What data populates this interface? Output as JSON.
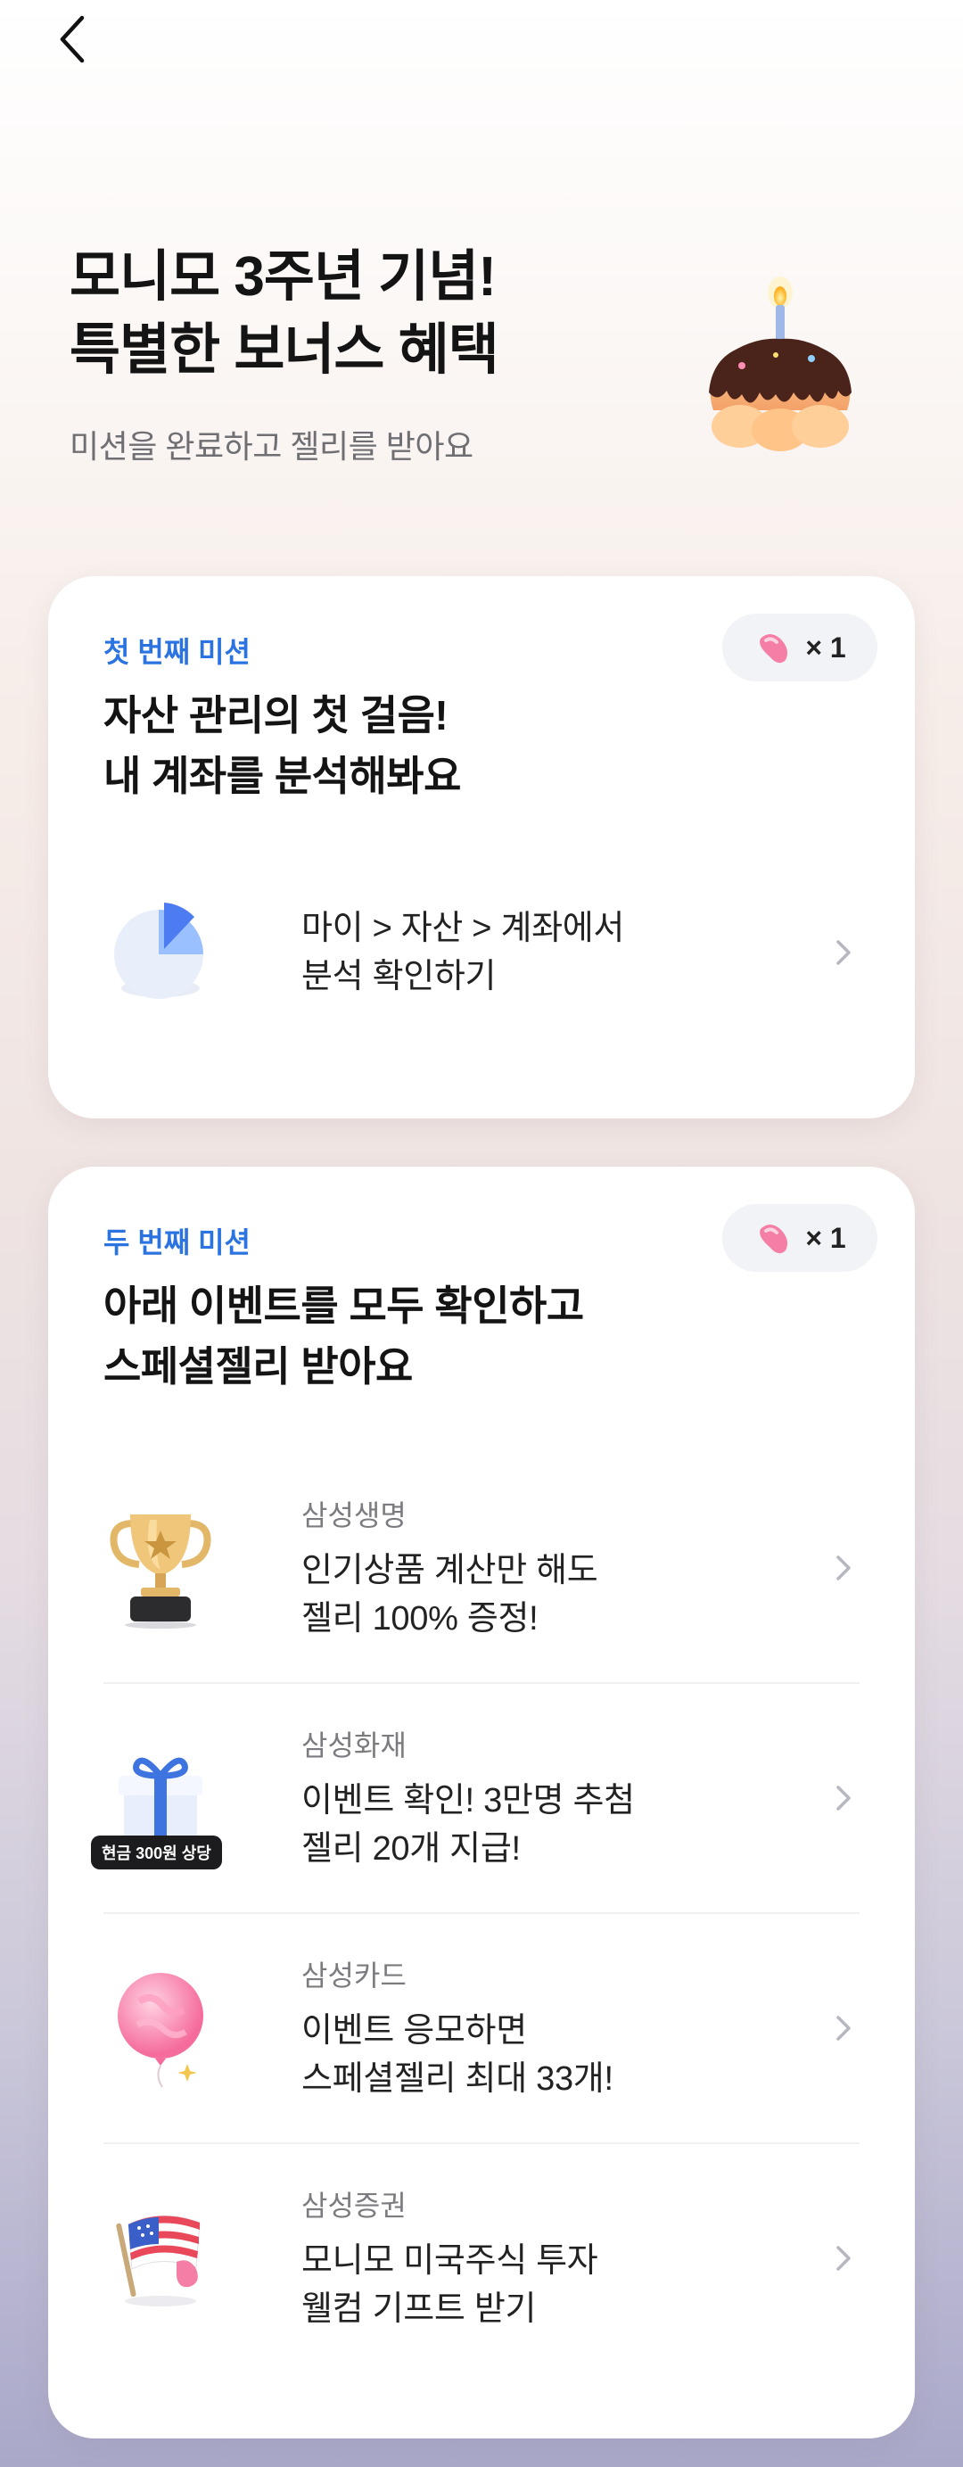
{
  "header": {
    "title_lines": [
      "모니모 3주년 기념!",
      "특별한 보너스 혜택"
    ],
    "subtitle": "미션을 완료하고 젤리를 받아요"
  },
  "mission1": {
    "label": "첫 번째 미션",
    "reward": "× 1",
    "title_lines": [
      "자산 관리의 첫 걸음!",
      "내 계좌를 분석해봐요"
    ],
    "item": {
      "icon": "pie-chart-icon",
      "lines": [
        "마이 > 자산 > 계좌에서",
        "분석 확인하기"
      ]
    }
  },
  "mission2": {
    "label": "두 번째 미션",
    "reward": "× 1",
    "title_lines": [
      "아래 이벤트를 모두 확인하고",
      "스페셜젤리 받아요"
    ],
    "items": [
      {
        "brand": "삼성생명",
        "icon": "trophy-icon",
        "lines": [
          "인기상품 계산만 해도",
          "젤리 100% 증정!"
        ]
      },
      {
        "brand": "삼성화재",
        "icon": "gift-box-icon",
        "badge": "현금 300원 상당",
        "lines": [
          "이벤트 확인! 3만명 추첨",
          "젤리 20개 지급!"
        ]
      },
      {
        "brand": "삼성카드",
        "icon": "balloon-icon",
        "lines": [
          "이벤트 응모하면",
          "스페셜젤리 최대 33개!"
        ]
      },
      {
        "brand": "삼성증권",
        "icon": "us-flag-icon",
        "lines": [
          "모니모 미국주식 투자",
          "웰컴 기프트 받기"
        ]
      }
    ]
  },
  "colors": {
    "accent": "#2a73e0",
    "jelly": "#f47ea6"
  }
}
